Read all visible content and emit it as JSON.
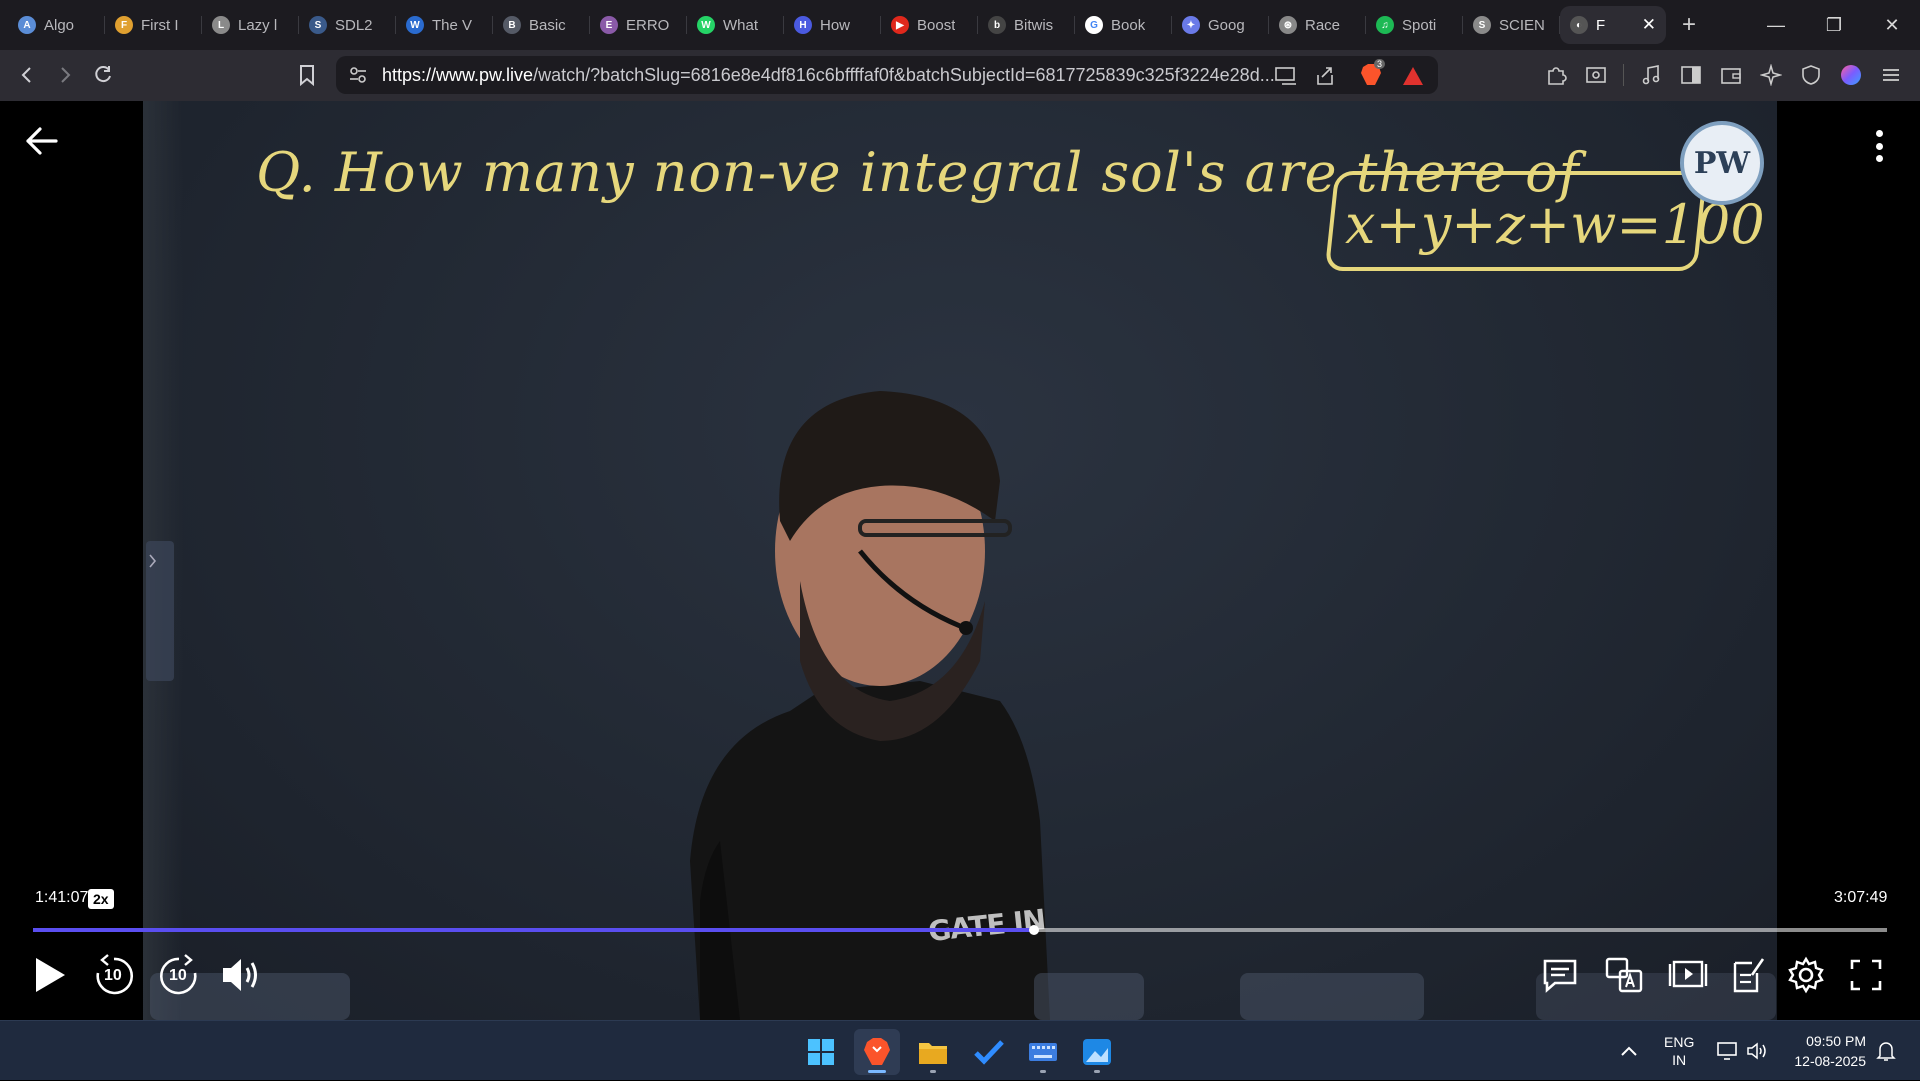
{
  "tabs": [
    {
      "label": "Algo",
      "color": "#5b8dd6",
      "glyph": "A"
    },
    {
      "label": "First I",
      "color": "#e0a030",
      "glyph": "F"
    },
    {
      "label": "Lazy l",
      "color": "#8a8a8a",
      "glyph": "L"
    },
    {
      "label": "SDL2",
      "color": "#3a5a8a",
      "glyph": "S"
    },
    {
      "label": "The V",
      "color": "#2a6bcf",
      "glyph": "W"
    },
    {
      "label": "Basic",
      "color": "#555a66",
      "glyph": "B"
    },
    {
      "label": "ERRO",
      "color": "#8a5aa8",
      "glyph": "E"
    },
    {
      "label": "What",
      "color": "#25d366",
      "glyph": "W"
    },
    {
      "label": "How",
      "color": "#4a5ae0",
      "glyph": "H"
    },
    {
      "label": "Boost",
      "color": "#e0281c",
      "glyph": "▶"
    },
    {
      "label": "Bitwis",
      "color": "#444",
      "glyph": "b"
    },
    {
      "label": "Book",
      "color": "#ffffff",
      "glyph": "G"
    },
    {
      "label": "Goog",
      "color": "#6a7ae8",
      "glyph": "✦"
    },
    {
      "label": "Race",
      "color": "#888",
      "glyph": "⊛"
    },
    {
      "label": "Spoti",
      "color": "#1db954",
      "glyph": "♫"
    },
    {
      "label": "SCIEN",
      "color": "#8a8a8a",
      "glyph": "S"
    }
  ],
  "active_tab": {
    "label": "F",
    "close": "✕"
  },
  "new_tab": "+",
  "window": {
    "minimize": "—",
    "restore": "❐",
    "close": "✕"
  },
  "address": {
    "host": "https://www.pw.live",
    "path": "/watch/?batchSlug=6816e8e4df816c6bffffaf0f&batchSubjectId=6817725839c325f3224e28d...",
    "brave_badge": "3"
  },
  "board": {
    "question": "Q. How many non-ve integral sol's are there of",
    "equation": "x+y+z+w=100",
    "logo": "PW",
    "shirt_text": "GATE IN"
  },
  "player": {
    "current_time": "1:41:07",
    "speed": "2x",
    "total_time": "3:07:49",
    "progress": 0.5399,
    "rewind_label": "10",
    "forward_label": "10"
  },
  "taskbar": {
    "lang_top": "ENG",
    "lang_bottom": "IN",
    "time": "09:50 PM",
    "date": "12-08-2025"
  }
}
